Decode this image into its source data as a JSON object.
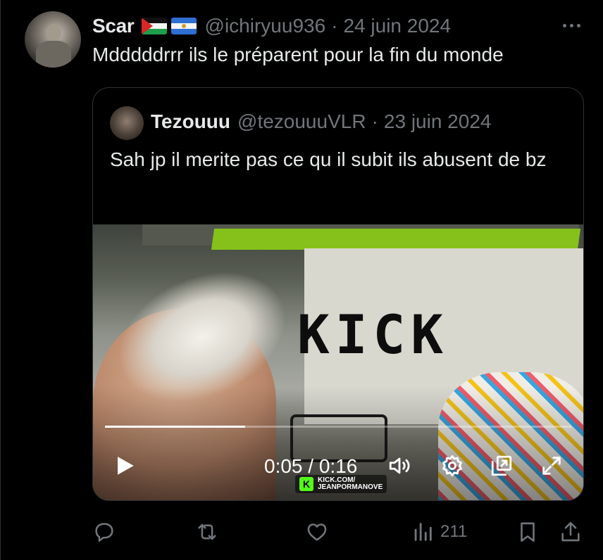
{
  "tweet": {
    "author_name": "Scar",
    "handle": "@ichiryuu936",
    "separator": "·",
    "date": "24 juin 2024",
    "text": "Mdddddrrr ils le préparent pour la fin du monde",
    "flags": [
      "palestine-flag",
      "nicaragua-flag"
    ]
  },
  "quote": {
    "author_name": "Tezouuu",
    "handle": "@tezouuuVLR",
    "separator": "·",
    "date": "23 juin 2024",
    "text": "Sah jp il merite pas ce qu il subit ils abusent de bz",
    "video": {
      "current_time": "0:05",
      "duration": "0:16",
      "time_display": "0:05 / 0:16",
      "progress_fraction": 0.3,
      "watermark_site": "KICK.COM/",
      "watermark_channel": "JEANPORMANOVE",
      "watermark_logo": "K",
      "scene_text": "KICK"
    }
  },
  "actions": {
    "views": "211"
  },
  "icons": {
    "more": "more-icon",
    "reply": "reply-icon",
    "repost": "repost-icon",
    "like": "like-icon",
    "views": "views-icon",
    "bookmark": "bookmark-icon",
    "share": "share-icon",
    "play": "play-icon",
    "volume": "volume-icon",
    "settings": "settings-icon",
    "pip": "pip-icon",
    "fullscreen": "fullscreen-icon"
  },
  "colors": {
    "background": "#000000",
    "text_primary": "#e7e9ea",
    "text_secondary": "#71767b",
    "border": "#2f3336",
    "kick_green": "#53fc18"
  }
}
